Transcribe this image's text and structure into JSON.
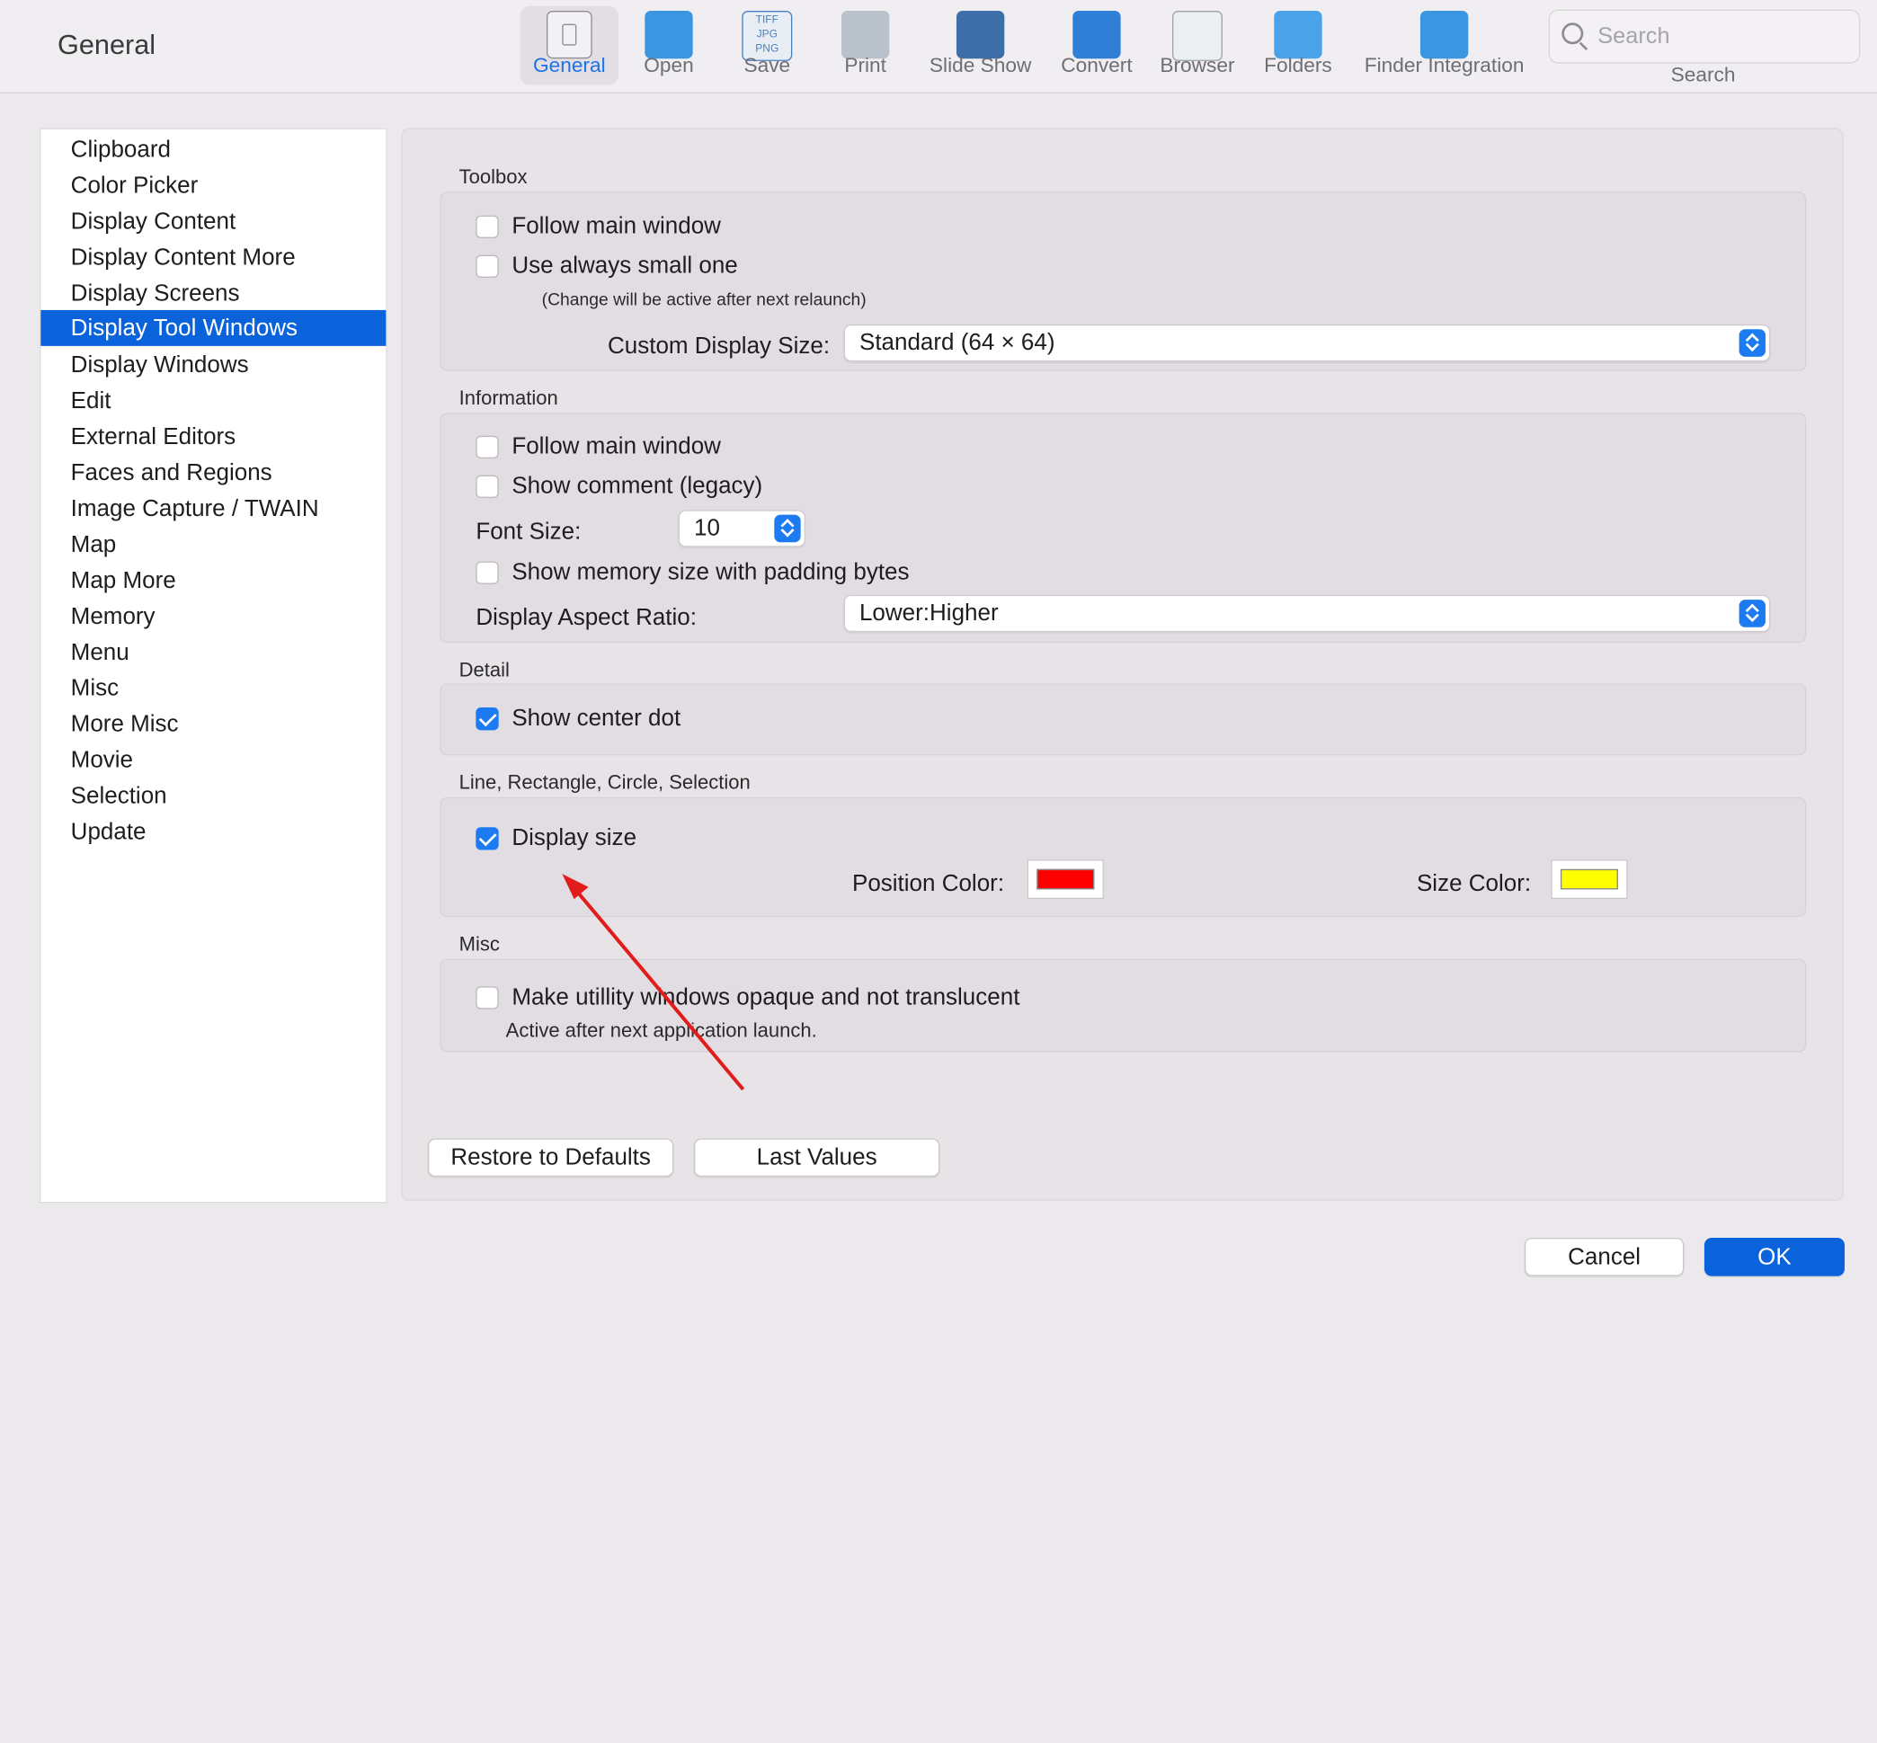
{
  "window": {
    "title": "General"
  },
  "toolbar": {
    "items": [
      {
        "label": "General",
        "icon": "general-icon",
        "color": "#8e8e93",
        "active": true
      },
      {
        "label": "Open",
        "icon": "open-folder-icon",
        "color": "#3a96e0"
      },
      {
        "label": "Save",
        "icon": "save-formats-icon",
        "color": "#4a7fc1"
      },
      {
        "label": "Print",
        "icon": "printer-icon",
        "color": "#7b8a99"
      },
      {
        "label": "Slide Show",
        "icon": "slideshow-icon",
        "color": "#3d6ea8"
      },
      {
        "label": "Convert",
        "icon": "convert-icon",
        "color": "#2f7fd6"
      },
      {
        "label": "Browser",
        "icon": "browser-icon",
        "color": "#9aa3ab"
      },
      {
        "label": "Folders",
        "icon": "folders-icon",
        "color": "#4aa3e8"
      },
      {
        "label": "Finder Integration",
        "icon": "finder-integration-icon",
        "color": "#3a96e0"
      }
    ],
    "search": {
      "placeholder": "Search",
      "caption": "Search"
    }
  },
  "sidebar": {
    "items": [
      "Clipboard",
      "Color Picker",
      "Display Content",
      "Display Content More",
      "Display Screens",
      "Display Tool Windows",
      "Display Windows",
      "Edit",
      "External Editors",
      "Faces and Regions",
      "Image Capture / TWAIN",
      "Map",
      "Map More",
      "Memory",
      "Menu",
      "Misc",
      "More Misc",
      "Movie",
      "Selection",
      "Update"
    ],
    "selected": "Display Tool Windows"
  },
  "toolbox": {
    "title": "Toolbox",
    "follow_main": "Follow main window",
    "use_small": "Use always small one",
    "note": "(Change will be active after next relaunch)",
    "size_label": "Custom Display Size:",
    "size_value": "Standard (64 × 64)"
  },
  "information": {
    "title": "Information",
    "follow_main": "Follow main window",
    "show_comment": "Show comment (legacy)",
    "font_size_label": "Font Size:",
    "font_size_value": "10",
    "show_memory": "Show memory size with padding bytes",
    "aspect_label": "Display Aspect Ratio:",
    "aspect_value": "Lower:Higher"
  },
  "detail": {
    "title": "Detail",
    "show_center_dot": "Show center dot"
  },
  "shapes": {
    "title": "Line, Rectangle, Circle, Selection",
    "display_size": "Display size",
    "position_color_label": "Position Color:",
    "position_color": "#ff0000",
    "size_color_label": "Size Color:",
    "size_color": "#ffff00"
  },
  "misc": {
    "title": "Misc",
    "opaque": "Make utillity windows opaque and not translucent",
    "note": "Active after next application launch."
  },
  "buttons": {
    "restore": "Restore to Defaults",
    "last_values": "Last Values",
    "cancel": "Cancel",
    "ok": "OK"
  },
  "accent": "#0a63db",
  "annotation_color": "#e21b1b"
}
